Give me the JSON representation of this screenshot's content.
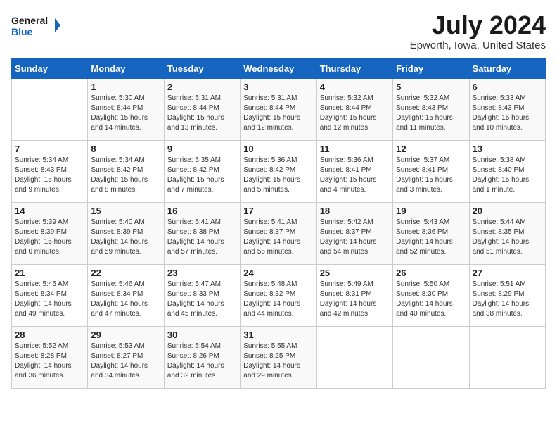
{
  "header": {
    "logo_line1": "General",
    "logo_line2": "Blue",
    "month_year": "July 2024",
    "location": "Epworth, Iowa, United States"
  },
  "days_of_week": [
    "Sunday",
    "Monday",
    "Tuesday",
    "Wednesday",
    "Thursday",
    "Friday",
    "Saturday"
  ],
  "weeks": [
    [
      null,
      {
        "day": "1",
        "sunrise": "5:30 AM",
        "sunset": "8:44 PM",
        "daylight": "15 hours and 14 minutes."
      },
      {
        "day": "2",
        "sunrise": "5:31 AM",
        "sunset": "8:44 PM",
        "daylight": "15 hours and 13 minutes."
      },
      {
        "day": "3",
        "sunrise": "5:31 AM",
        "sunset": "8:44 PM",
        "daylight": "15 hours and 12 minutes."
      },
      {
        "day": "4",
        "sunrise": "5:32 AM",
        "sunset": "8:44 PM",
        "daylight": "15 hours and 12 minutes."
      },
      {
        "day": "5",
        "sunrise": "5:32 AM",
        "sunset": "8:43 PM",
        "daylight": "15 hours and 11 minutes."
      },
      {
        "day": "6",
        "sunrise": "5:33 AM",
        "sunset": "8:43 PM",
        "daylight": "15 hours and 10 minutes."
      }
    ],
    [
      {
        "day": "7",
        "sunrise": "5:34 AM",
        "sunset": "8:43 PM",
        "daylight": "15 hours and 9 minutes."
      },
      {
        "day": "8",
        "sunrise": "5:34 AM",
        "sunset": "8:42 PM",
        "daylight": "15 hours and 8 minutes."
      },
      {
        "day": "9",
        "sunrise": "5:35 AM",
        "sunset": "8:42 PM",
        "daylight": "15 hours and 7 minutes."
      },
      {
        "day": "10",
        "sunrise": "5:36 AM",
        "sunset": "8:42 PM",
        "daylight": "15 hours and 5 minutes."
      },
      {
        "day": "11",
        "sunrise": "5:36 AM",
        "sunset": "8:41 PM",
        "daylight": "15 hours and 4 minutes."
      },
      {
        "day": "12",
        "sunrise": "5:37 AM",
        "sunset": "8:41 PM",
        "daylight": "15 hours and 3 minutes."
      },
      {
        "day": "13",
        "sunrise": "5:38 AM",
        "sunset": "8:40 PM",
        "daylight": "15 hours and 1 minute."
      }
    ],
    [
      {
        "day": "14",
        "sunrise": "5:39 AM",
        "sunset": "8:39 PM",
        "daylight": "15 hours and 0 minutes."
      },
      {
        "day": "15",
        "sunrise": "5:40 AM",
        "sunset": "8:39 PM",
        "daylight": "14 hours and 59 minutes."
      },
      {
        "day": "16",
        "sunrise": "5:41 AM",
        "sunset": "8:38 PM",
        "daylight": "14 hours and 57 minutes."
      },
      {
        "day": "17",
        "sunrise": "5:41 AM",
        "sunset": "8:37 PM",
        "daylight": "14 hours and 56 minutes."
      },
      {
        "day": "18",
        "sunrise": "5:42 AM",
        "sunset": "8:37 PM",
        "daylight": "14 hours and 54 minutes."
      },
      {
        "day": "19",
        "sunrise": "5:43 AM",
        "sunset": "8:36 PM",
        "daylight": "14 hours and 52 minutes."
      },
      {
        "day": "20",
        "sunrise": "5:44 AM",
        "sunset": "8:35 PM",
        "daylight": "14 hours and 51 minutes."
      }
    ],
    [
      {
        "day": "21",
        "sunrise": "5:45 AM",
        "sunset": "8:34 PM",
        "daylight": "14 hours and 49 minutes."
      },
      {
        "day": "22",
        "sunrise": "5:46 AM",
        "sunset": "8:34 PM",
        "daylight": "14 hours and 47 minutes."
      },
      {
        "day": "23",
        "sunrise": "5:47 AM",
        "sunset": "8:33 PM",
        "daylight": "14 hours and 45 minutes."
      },
      {
        "day": "24",
        "sunrise": "5:48 AM",
        "sunset": "8:32 PM",
        "daylight": "14 hours and 44 minutes."
      },
      {
        "day": "25",
        "sunrise": "5:49 AM",
        "sunset": "8:31 PM",
        "daylight": "14 hours and 42 minutes."
      },
      {
        "day": "26",
        "sunrise": "5:50 AM",
        "sunset": "8:30 PM",
        "daylight": "14 hours and 40 minutes."
      },
      {
        "day": "27",
        "sunrise": "5:51 AM",
        "sunset": "8:29 PM",
        "daylight": "14 hours and 38 minutes."
      }
    ],
    [
      {
        "day": "28",
        "sunrise": "5:52 AM",
        "sunset": "8:28 PM",
        "daylight": "14 hours and 36 minutes."
      },
      {
        "day": "29",
        "sunrise": "5:53 AM",
        "sunset": "8:27 PM",
        "daylight": "14 hours and 34 minutes."
      },
      {
        "day": "30",
        "sunrise": "5:54 AM",
        "sunset": "8:26 PM",
        "daylight": "14 hours and 32 minutes."
      },
      {
        "day": "31",
        "sunrise": "5:55 AM",
        "sunset": "8:25 PM",
        "daylight": "14 hours and 29 minutes."
      },
      null,
      null,
      null
    ]
  ],
  "labels": {
    "sunrise": "Sunrise:",
    "sunset": "Sunset:",
    "daylight": "Daylight:"
  }
}
